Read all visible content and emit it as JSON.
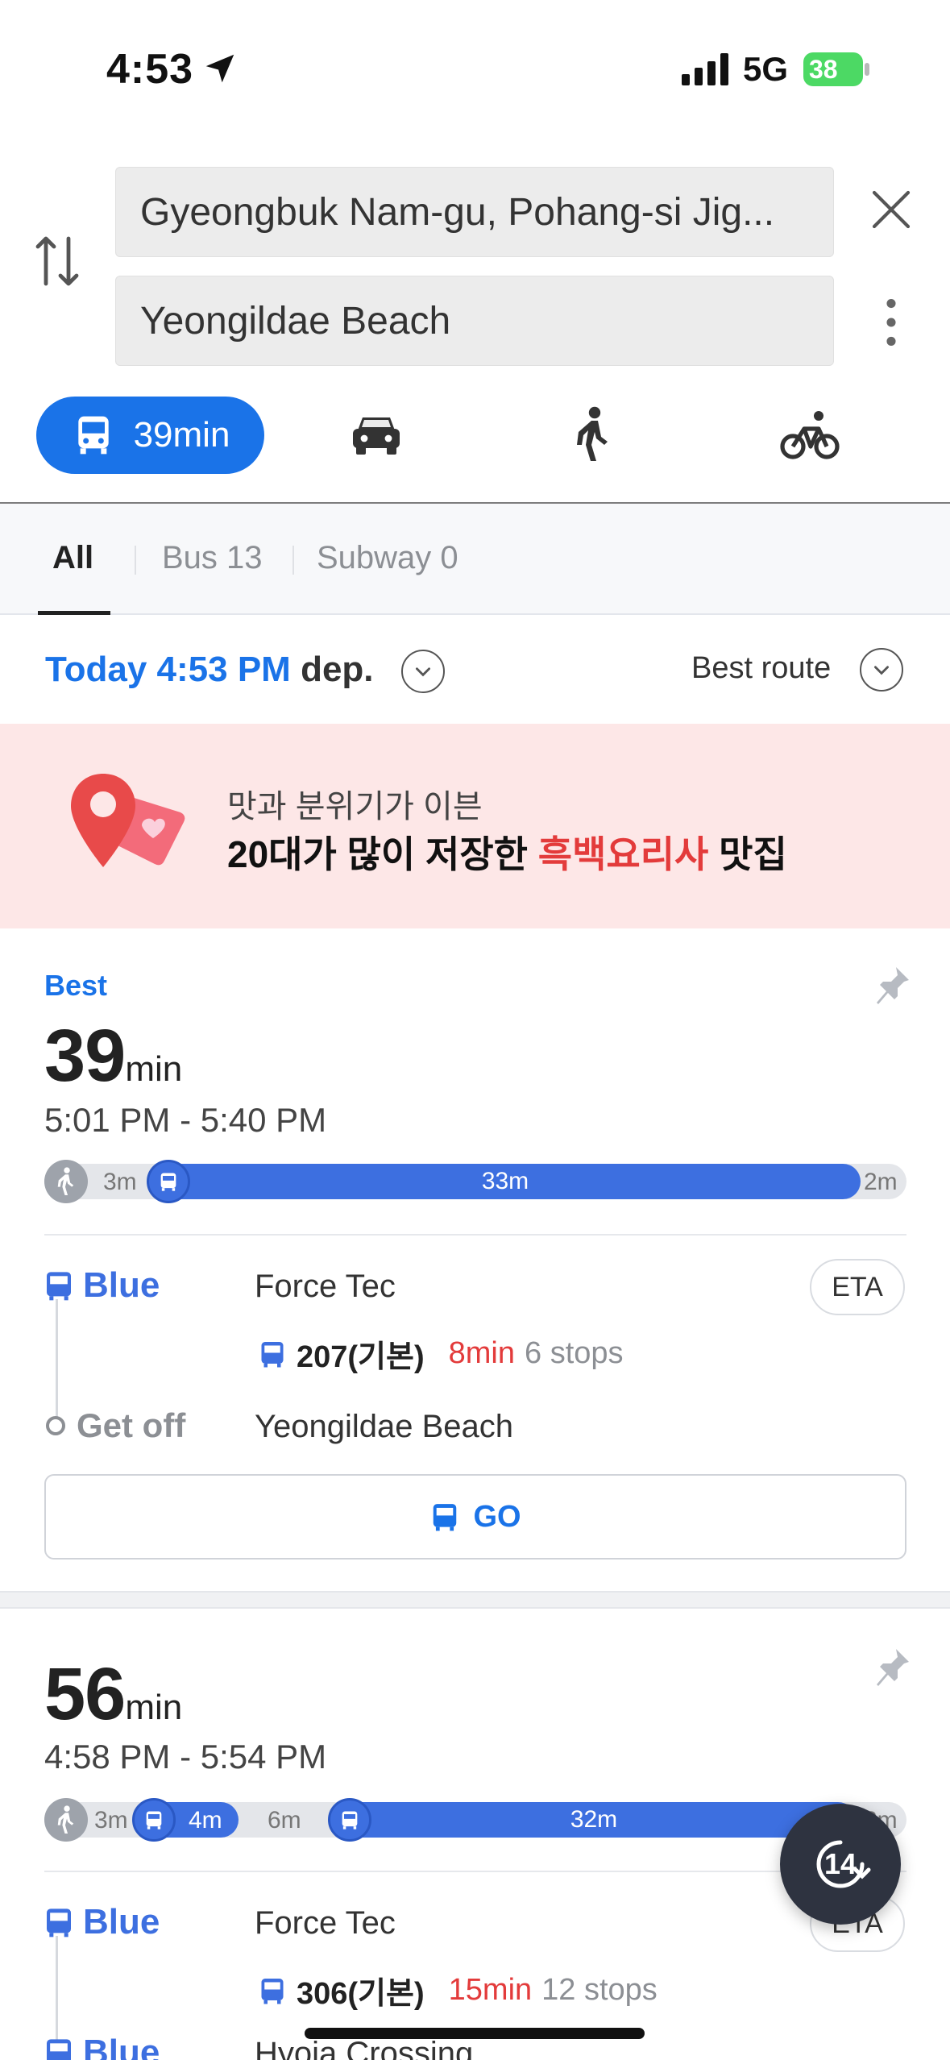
{
  "status_bar": {
    "time": "4:53",
    "network": "5G",
    "battery": "38"
  },
  "search": {
    "origin": "Gyeongbuk Nam-gu, Pohang-si Jig...",
    "destination": "Yeongildae Beach"
  },
  "modes": {
    "transit_label": "39min"
  },
  "filters": {
    "all": "All",
    "bus": "Bus 13",
    "subway": "Subway 0"
  },
  "departure": {
    "today": "Today 4:53 PM",
    "dep": "dep.",
    "sort": "Best route"
  },
  "banner": {
    "line1": "맛과 분위기가 이븐",
    "line2_a": "20대가 많이 저장한 ",
    "line2_highlight": "흑백요리사",
    "line2_b": " 맛집"
  },
  "routes": [
    {
      "tag": "Best",
      "duration": "39",
      "unit": "min",
      "times": "5:01 PM - 5:40 PM",
      "bar": {
        "walk_start": "3m",
        "bus": "33m",
        "walk_end": "2m"
      },
      "leg_label": "Blue",
      "stop": "Force Tec",
      "eta": "ETA",
      "bus_num": "207(기본)",
      "bus_min": "8min",
      "bus_stops": "6 stops",
      "getoff_label": "Get off",
      "getoff_stop": "Yeongildae Beach",
      "go": "GO"
    },
    {
      "duration": "56",
      "unit": "min",
      "times": "4:58 PM - 5:54 PM",
      "bar": {
        "walk_start": "3m",
        "bus1": "4m",
        "walk_mid": "6m",
        "bus2": "32m",
        "walk_end": "2m"
      },
      "leg_label": "Blue",
      "stop": "Force Tec",
      "eta": "ETA",
      "bus_num": "306(기본)",
      "bus_min": "15min",
      "bus_stops": "12 stops",
      "leg2_label": "Blue",
      "leg2_stop": "Hyoja Crossing"
    }
  ],
  "fab": {
    "label": "14"
  }
}
